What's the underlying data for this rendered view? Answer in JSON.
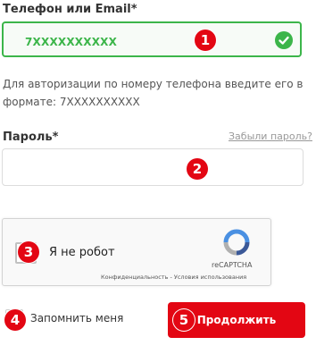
{
  "login": {
    "phone_label": "Телефон или Email*",
    "phone_value": "7XXXXXXXXXX",
    "phone_hint": "Для авторизации по номеру телефона введите его в формате: 7XXXXXXXXXX",
    "password_label": "Пароль*",
    "forgot_link": "Забыли пароль?",
    "remember_label": "Запомнить меня",
    "submit_label": "Продолжить"
  },
  "captcha": {
    "label": "Я не робот",
    "brand": "reCAPTCHA",
    "terms": "Конфиденциальность - Условия использования"
  },
  "markers": [
    "1",
    "2",
    "3",
    "4",
    "5"
  ],
  "colors": {
    "valid_green": "#3cb54a",
    "accent_red": "#e30613"
  },
  "icons": {
    "valid": "check-icon",
    "captcha": "recaptcha-logo-icon"
  }
}
